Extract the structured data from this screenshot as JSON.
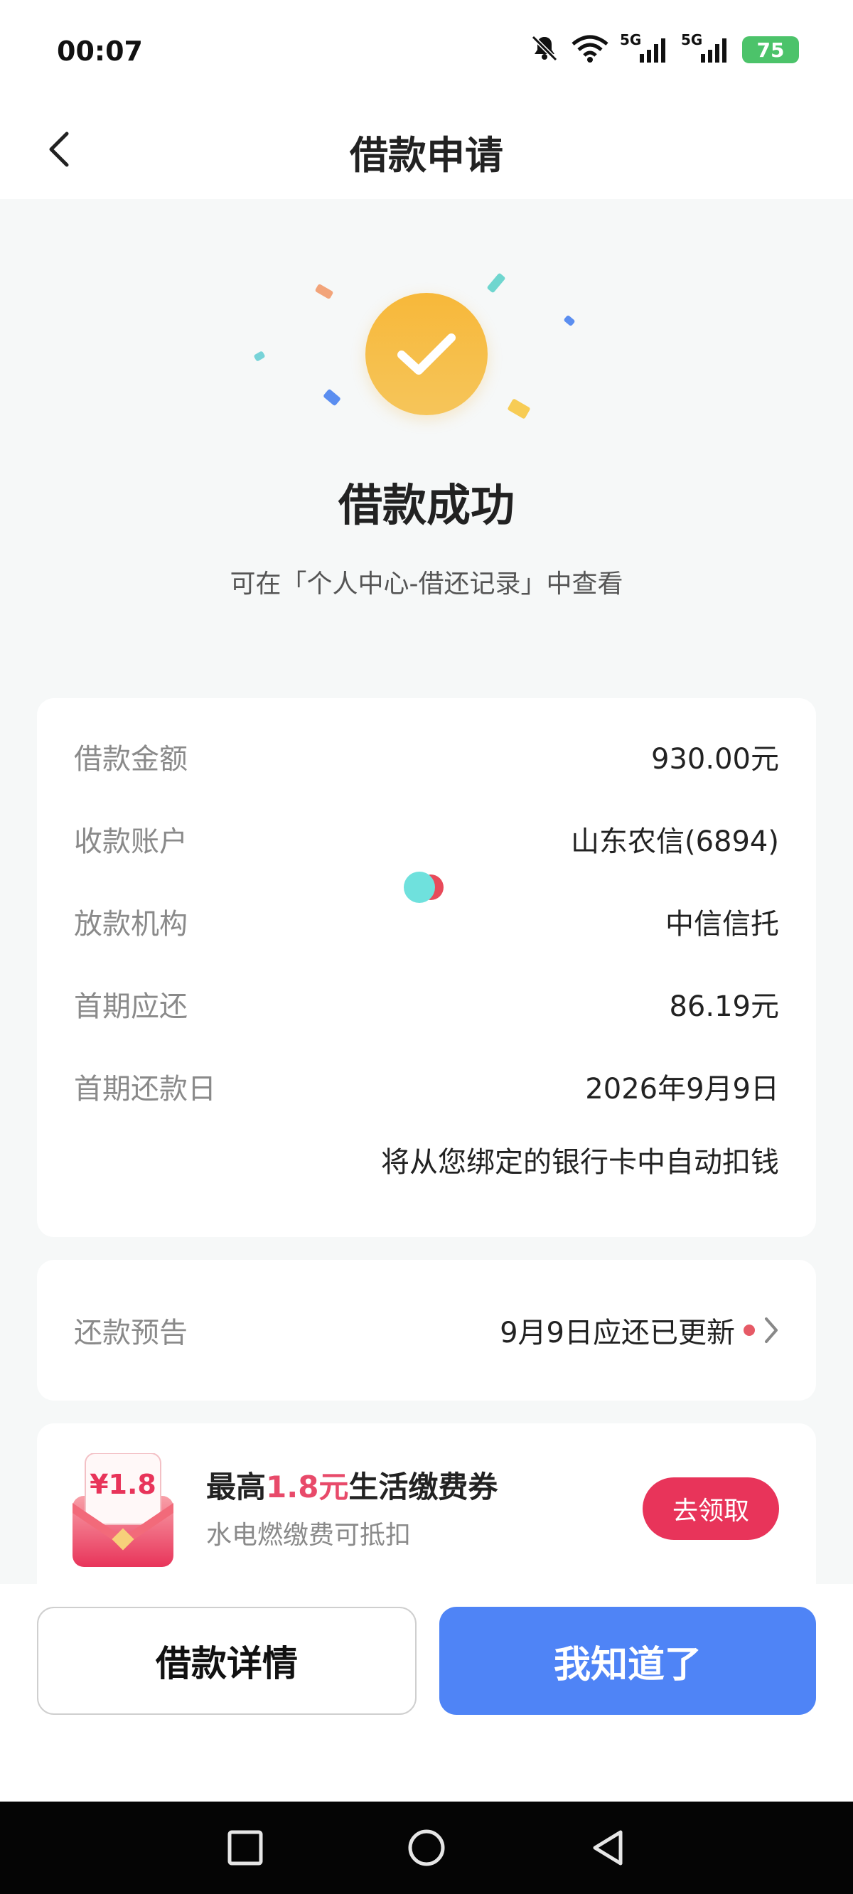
{
  "status_bar": {
    "time": "00:07",
    "signal_1": "5G",
    "signal_2": "5G",
    "battery": "75"
  },
  "navbar": {
    "title": "借款申请"
  },
  "hero": {
    "title": "借款成功",
    "subtitle": "可在「个人中心-借还记录」中查看"
  },
  "info": {
    "rows": [
      {
        "label": "借款金额",
        "value": "930.00元"
      },
      {
        "label": "收款账户",
        "value": "山东农信(6894)"
      },
      {
        "label": "放款机构",
        "value": "中信信托"
      },
      {
        "label": "首期应还",
        "value": "86.19元"
      },
      {
        "label": "首期还款日",
        "value": "2026年9月9日"
      }
    ],
    "note": "将从您绑定的银行卡中自动扣钱"
  },
  "preview": {
    "label": "还款预告",
    "value": "9月9日应还已更新"
  },
  "coupon": {
    "badge": "¥1.8",
    "title_prefix": "最高",
    "title_accent": "1.8元",
    "title_suffix": "生活缴费券",
    "subtitle": "水电燃缴费可抵扣",
    "button": "去领取"
  },
  "actions": {
    "detail": "借款详情",
    "ok": "我知道了"
  },
  "colors": {
    "primary_blue": "#4f84f6",
    "accent_red": "#e8345a",
    "success_yellow": "#f7b83a"
  }
}
